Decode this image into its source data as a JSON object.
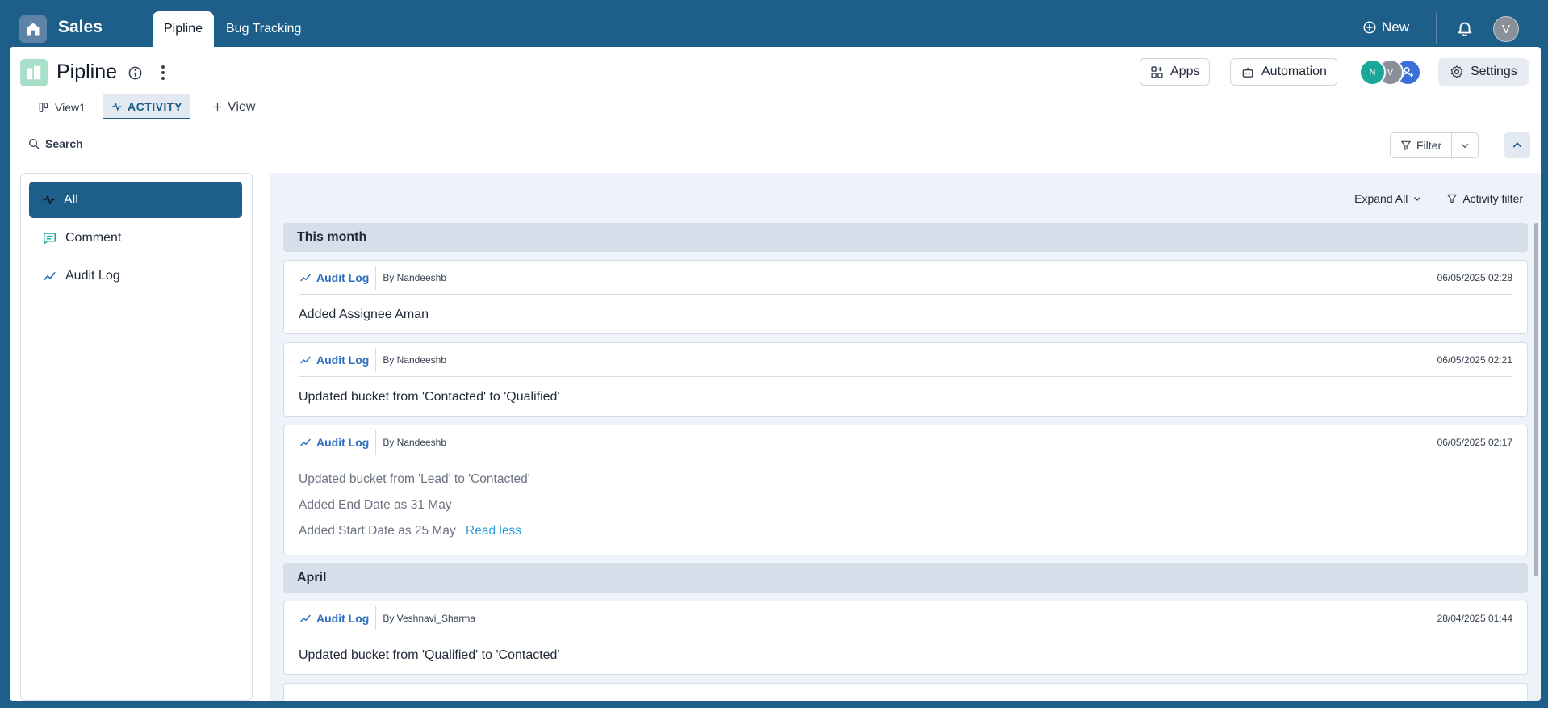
{
  "header": {
    "app_title": "Sales",
    "tabs": [
      "Pipline",
      "Bug Tracking"
    ],
    "new_label": "New",
    "user_initial": "V"
  },
  "page": {
    "title": "Pipline",
    "apps_label": "Apps",
    "automation_label": "Automation",
    "members": [
      "N",
      "V"
    ],
    "settings_label": "Settings"
  },
  "view_tabs": {
    "view1": "View1",
    "activity": "ACTIVITY",
    "add_view": "View"
  },
  "toolbar": {
    "search_placeholder": "Search",
    "filter_label": "Filter"
  },
  "sidebar": {
    "items": [
      "All",
      "Comment",
      "Audit Log"
    ]
  },
  "feed": {
    "expand_all": "Expand All",
    "activity_filter": "Activity filter",
    "groups": [
      {
        "title": "This month",
        "entries": [
          {
            "type": "Audit Log",
            "by": "By Nandeeshb",
            "time": "06/05/2025 02:28",
            "lines": [
              "Added Assignee Aman"
            ]
          },
          {
            "type": "Audit Log",
            "by": "By Nandeeshb",
            "time": "06/05/2025 02:21",
            "lines": [
              "Updated bucket from 'Contacted' to 'Qualified'"
            ]
          },
          {
            "type": "Audit Log",
            "by": "By Nandeeshb",
            "time": "06/05/2025 02:17",
            "lines": [
              "Updated bucket from 'Lead' to 'Contacted'",
              "Added End Date as 31 May",
              "Added Start Date as 25 May"
            ],
            "toggle": "Read less"
          }
        ]
      },
      {
        "title": "April",
        "entries": [
          {
            "type": "Audit Log",
            "by": "By Veshnavi_Sharma",
            "time": "28/04/2025 01:44",
            "lines": [
              "Updated bucket from 'Qualified' to 'Contacted'"
            ]
          }
        ]
      }
    ]
  },
  "colors": {
    "brand": "#1d5f89",
    "accent_link": "#2d6fc0",
    "read_less": "#2d9cdb",
    "member_n": "#1aa89a",
    "member_v": "#8a9099",
    "add_member": "#3b6fd8"
  }
}
